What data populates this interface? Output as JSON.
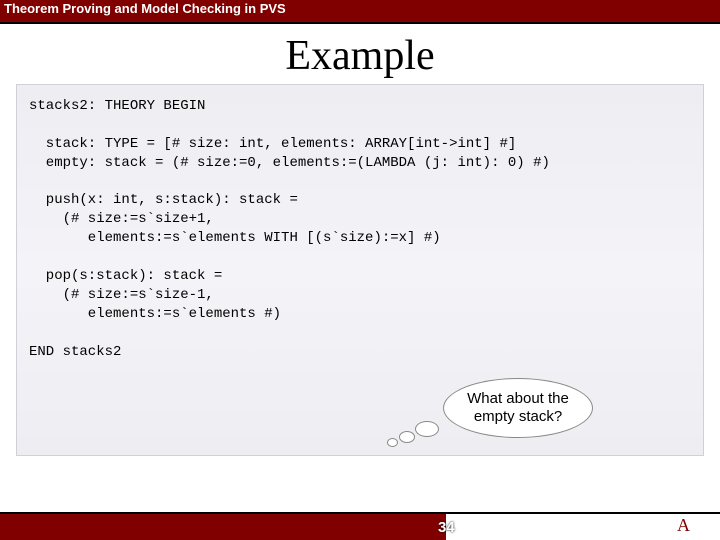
{
  "header": {
    "title": "Theorem Proving and Model Checking in PVS"
  },
  "slide": {
    "title": "Example",
    "code": "stacks2: THEORY BEGIN\n\n  stack: TYPE = [# size: int, elements: ARRAY[int->int] #]\n  empty: stack = (# size:=0, elements:=(LAMBDA (j: int): 0) #)\n\n  push(x: int, s:stack): stack =\n    (# size:=s`size+1,\n       elements:=s`elements WITH [(s`size):=x] #)\n\n  pop(s:stack): stack =\n    (# size:=s`size-1,\n       elements:=s`elements #)\n\nEND stacks2",
    "bubble_text": "What about the empty stack?"
  },
  "footer": {
    "page_number": "34",
    "letter": "A"
  }
}
